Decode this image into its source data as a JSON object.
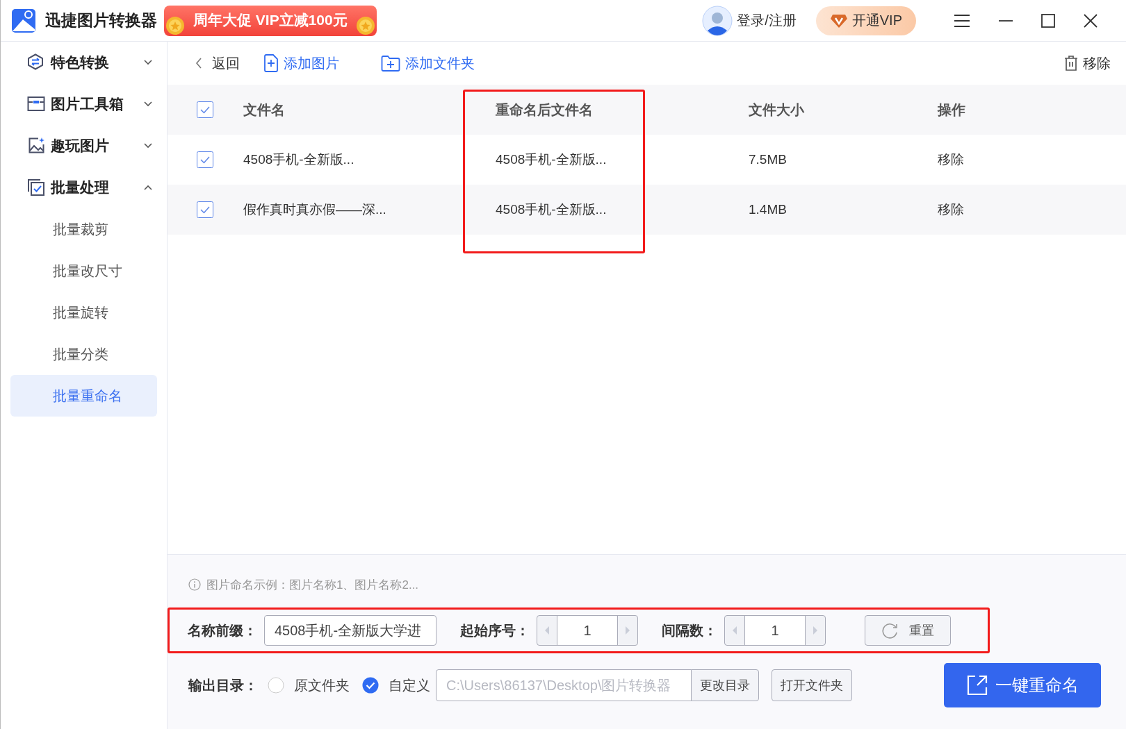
{
  "app": {
    "title": "迅捷图片转换器",
    "promo": "周年大促 VIP立减100元",
    "login": "登录/注册",
    "vip": "开通VIP"
  },
  "sidebar": {
    "groups": [
      {
        "label": "特色转换",
        "kind": "swap",
        "expanded": false
      },
      {
        "label": "图片工具箱",
        "kind": "toolbox",
        "expanded": false
      },
      {
        "label": "趣玩图片",
        "kind": "sparkle",
        "expanded": false
      },
      {
        "label": "批量处理",
        "kind": "batch",
        "expanded": true,
        "children": [
          {
            "label": "批量裁剪",
            "selected": false
          },
          {
            "label": "批量改尺寸",
            "selected": false
          },
          {
            "label": "批量旋转",
            "selected": false
          },
          {
            "label": "批量分类",
            "selected": false
          },
          {
            "label": "批量重命名",
            "selected": true
          }
        ]
      }
    ]
  },
  "toolbar": {
    "back": "返回",
    "add_image": "添加图片",
    "add_folder": "添加文件夹",
    "remove": "移除"
  },
  "table": {
    "all_checked": true,
    "columns": [
      "文件名",
      "重命名后文件名",
      "文件大小",
      "操作"
    ],
    "rows": [
      {
        "checked": true,
        "name": "4508手机-全新版...",
        "new_name": "4508手机-全新版...",
        "size": "7.5MB",
        "action": "移除"
      },
      {
        "checked": true,
        "name": "假作真时真亦假——深...",
        "new_name": "4508手机-全新版...",
        "size": "1.4MB",
        "action": "移除"
      }
    ]
  },
  "settings": {
    "hint": "图片命名示例：图片名称1、图片名称2...",
    "prefix_label": "名称前缀：",
    "prefix_value": "4508手机-全新版大学进",
    "start_label": "起始序号：",
    "start_value": "1",
    "step_label": "间隔数：",
    "step_value": "1",
    "reset": "重置"
  },
  "output": {
    "label": "输出目录：",
    "options": [
      {
        "label": "原文件夹",
        "selected": false
      },
      {
        "label": "自定义",
        "selected": true
      }
    ],
    "path": "C:\\Users\\86137\\Desktop\\图片转换器",
    "change": "更改目录",
    "open": "打开文件夹"
  },
  "primary_button": "一键重命名"
}
